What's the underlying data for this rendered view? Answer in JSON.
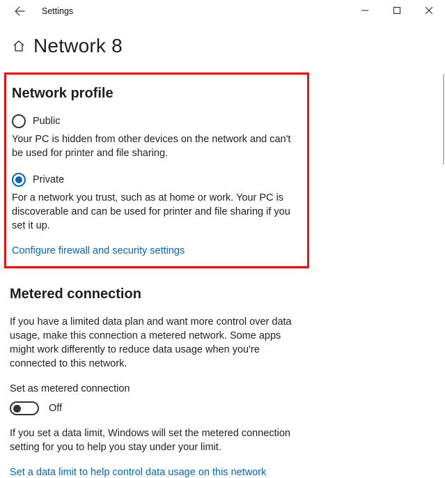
{
  "titlebar": {
    "app_name": "Settings"
  },
  "header": {
    "title": "Network 8"
  },
  "profile": {
    "heading": "Network profile",
    "public": {
      "label": "Public",
      "desc": "Your PC is hidden from other devices on the network and can't be used for printer and file sharing."
    },
    "private": {
      "label": "Private",
      "desc": "For a network you trust, such as at home or work. Your PC is discoverable and can be used for printer and file sharing if you set it up."
    },
    "firewall_link": "Configure firewall and security settings"
  },
  "metered": {
    "heading": "Metered connection",
    "desc1": "If you have a limited data plan and want more control over data usage, make this connection a metered network. Some apps might work differently to reduce data usage when you're connected to this network.",
    "toggle_label": "Set as metered connection",
    "toggle_state": "Off",
    "desc2": "If you set a data limit, Windows will set the metered connection setting for you to help you stay under your limit.",
    "data_limit_link": "Set a data limit to help control data usage on this network"
  }
}
